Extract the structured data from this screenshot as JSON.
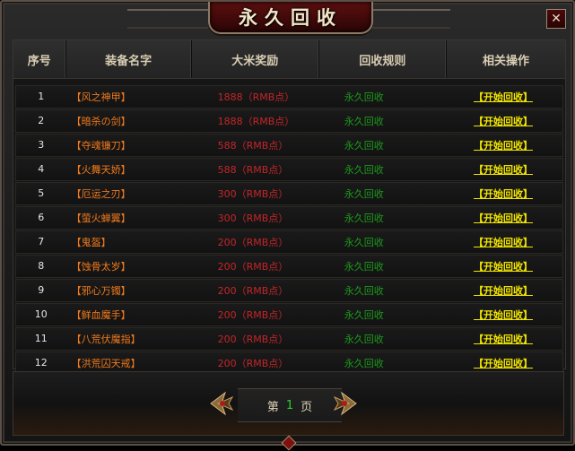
{
  "window": {
    "title": "永久回收",
    "close_label": "✕"
  },
  "table": {
    "headers": [
      "序号",
      "装备名字",
      "大米奖励",
      "回收规则",
      "相关操作"
    ],
    "rows": [
      {
        "no": "1",
        "name": "【风之神甲】",
        "reward": "1888（RMB点）",
        "rule": "永久回收",
        "action": "【开始回收】"
      },
      {
        "no": "2",
        "name": "【暗杀の剑】",
        "reward": "1888（RMB点）",
        "rule": "永久回收",
        "action": "【开始回收】"
      },
      {
        "no": "3",
        "name": "【夺魂镰刀】",
        "reward": "588（RMB点）",
        "rule": "永久回收",
        "action": "【开始回收】"
      },
      {
        "no": "4",
        "name": "【火舞天娇】",
        "reward": "588（RMB点）",
        "rule": "永久回收",
        "action": "【开始回收】"
      },
      {
        "no": "5",
        "name": "【厄运之刃】",
        "reward": "300（RMB点）",
        "rule": "永久回收",
        "action": "【开始回收】"
      },
      {
        "no": "6",
        "name": "【萤火蝉翼】",
        "reward": "300（RMB点）",
        "rule": "永久回收",
        "action": "【开始回收】"
      },
      {
        "no": "7",
        "name": "【鬼盔】",
        "reward": "200（RMB点）",
        "rule": "永久回收",
        "action": "【开始回收】"
      },
      {
        "no": "8",
        "name": "【蚀骨太岁】",
        "reward": "200（RMB点）",
        "rule": "永久回收",
        "action": "【开始回收】"
      },
      {
        "no": "9",
        "name": "【邪心万镯】",
        "reward": "200（RMB点）",
        "rule": "永久回收",
        "action": "【开始回收】"
      },
      {
        "no": "10",
        "name": "【鲜血魔手】",
        "reward": "200（RMB点）",
        "rule": "永久回收",
        "action": "【开始回收】"
      },
      {
        "no": "11",
        "name": "【八荒伏魔指】",
        "reward": "200（RMB点）",
        "rule": "永久回收",
        "action": "【开始回收】"
      },
      {
        "no": "12",
        "name": "【洪荒囚天戒】",
        "reward": "200（RMB点）",
        "rule": "永久回收",
        "action": "【开始回收】"
      }
    ]
  },
  "pager": {
    "prefix": "第",
    "page": "1",
    "suffix": "页"
  },
  "colors": {
    "name": "#f07a1c",
    "reward": "#c3262a",
    "rule": "#1c9a1c",
    "action": "#f2e500",
    "title_bg": "#5c0f0f"
  },
  "icons": {
    "close": "close-icon",
    "prev": "arrow-left-icon",
    "next": "arrow-right-icon"
  }
}
